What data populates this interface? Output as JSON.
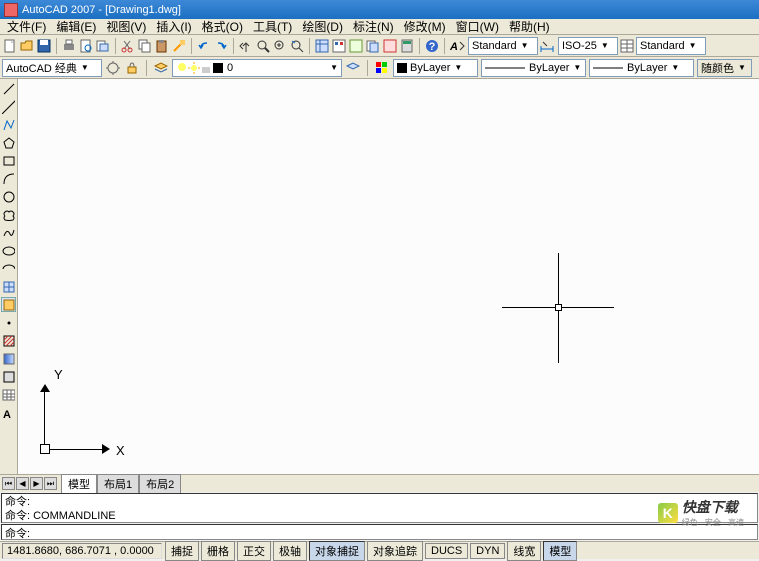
{
  "title": "AutoCAD 2007 - [Drawing1.dwg]",
  "menus": [
    "文件(F)",
    "编辑(E)",
    "视图(V)",
    "插入(I)",
    "格式(O)",
    "工具(T)",
    "绘图(D)",
    "标注(N)",
    "修改(M)",
    "窗口(W)",
    "帮助(H)"
  ],
  "textstyle": "Standard",
  "dimstyle": "ISO-25",
  "tablestyle": "Standard",
  "workspace": "AutoCAD 经典",
  "layer": "0",
  "prop_layer": "ByLayer",
  "prop_ltype": "ByLayer",
  "prop_lweight": "ByLayer",
  "prop_color": "随颜色",
  "ucs": {
    "x": "X",
    "y": "Y"
  },
  "tabs": {
    "model": "模型",
    "layout1": "布局1",
    "layout2": "布局2"
  },
  "cmd": {
    "line1": "命令:",
    "line2": "命令: COMMANDLINE",
    "prompt": "命令:"
  },
  "coords": "1481.8680, 686.7071 , 0.0000",
  "status_btns": [
    "捕捉",
    "栅格",
    "正交",
    "极轴",
    "对象捕捉",
    "对象追踪",
    "DUCS",
    "DYN",
    "线宽",
    "模型"
  ],
  "watermark": {
    "brand": "快盘下载",
    "sub": "绿色 · 安全 · 高速"
  }
}
